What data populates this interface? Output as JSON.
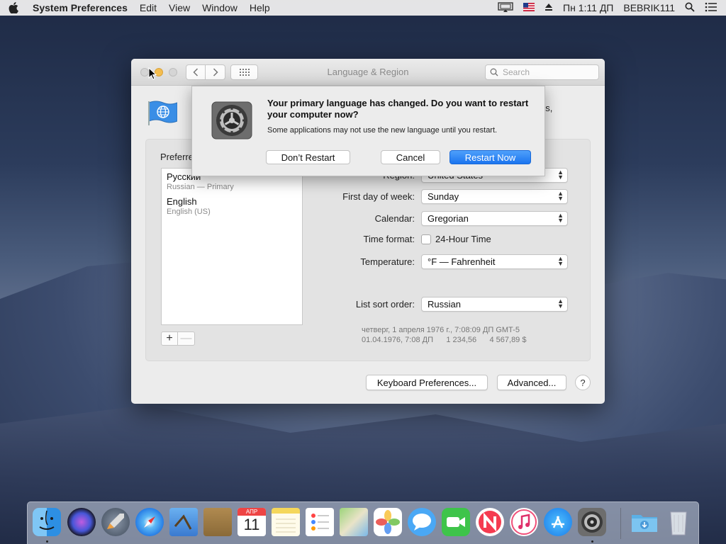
{
  "menubar": {
    "app_name": "System Preferences",
    "items": [
      "Edit",
      "View",
      "Window",
      "Help"
    ],
    "clock": "Пн 1:11 ДП",
    "user": "BEBRIK111"
  },
  "window": {
    "title": "Language & Region",
    "search_placeholder": "Search",
    "header_tail": "gs,"
  },
  "preferred": {
    "label": "Preferre",
    "languages": [
      {
        "name": "Русский",
        "sub": "Russian — Primary"
      },
      {
        "name": "English",
        "sub": "English (US)"
      }
    ],
    "add": "+",
    "remove": "—"
  },
  "settings": {
    "region": {
      "label": "Region:",
      "value": "United States"
    },
    "first_day": {
      "label": "First day of week:",
      "value": "Sunday"
    },
    "calendar": {
      "label": "Calendar:",
      "value": "Gregorian"
    },
    "time_format": {
      "label": "Time format:",
      "checkbox_label": "24-Hour Time",
      "checked": false
    },
    "temperature": {
      "label": "Temperature:",
      "value": "°F — Fahrenheit"
    },
    "sort_order": {
      "label": "List sort order:",
      "value": "Russian"
    }
  },
  "example": {
    "line1": "четверг, 1 апреля 1976 г., 7:08:09 ДП GMT-5",
    "line2": "01.04.1976, 7:08 ДП      1 234,56      4 567,89 $"
  },
  "buttons": {
    "keyboard": "Keyboard Preferences...",
    "advanced": "Advanced...",
    "help": "?"
  },
  "sheet": {
    "title": "Your primary language has changed. Do you want to restart your computer now?",
    "message": "Some applications may not use the new language until you restart.",
    "dont_restart": "Don’t Restart",
    "cancel": "Cancel",
    "restart_now": "Restart Now"
  },
  "dock": {
    "calendar_month": "АПР",
    "calendar_day": "11",
    "items": [
      "finder-icon",
      "siri-icon",
      "launchpad-icon",
      "safari-icon",
      "mail-icon",
      "contacts-icon",
      "calendar-icon",
      "notes-icon",
      "reminders-icon",
      "maps-icon",
      "photos-icon",
      "messages-icon",
      "facetime-icon",
      "news-icon",
      "music-icon",
      "app-store-icon",
      "system-preferences-icon",
      "downloads-folder-icon",
      "trash-icon"
    ]
  }
}
